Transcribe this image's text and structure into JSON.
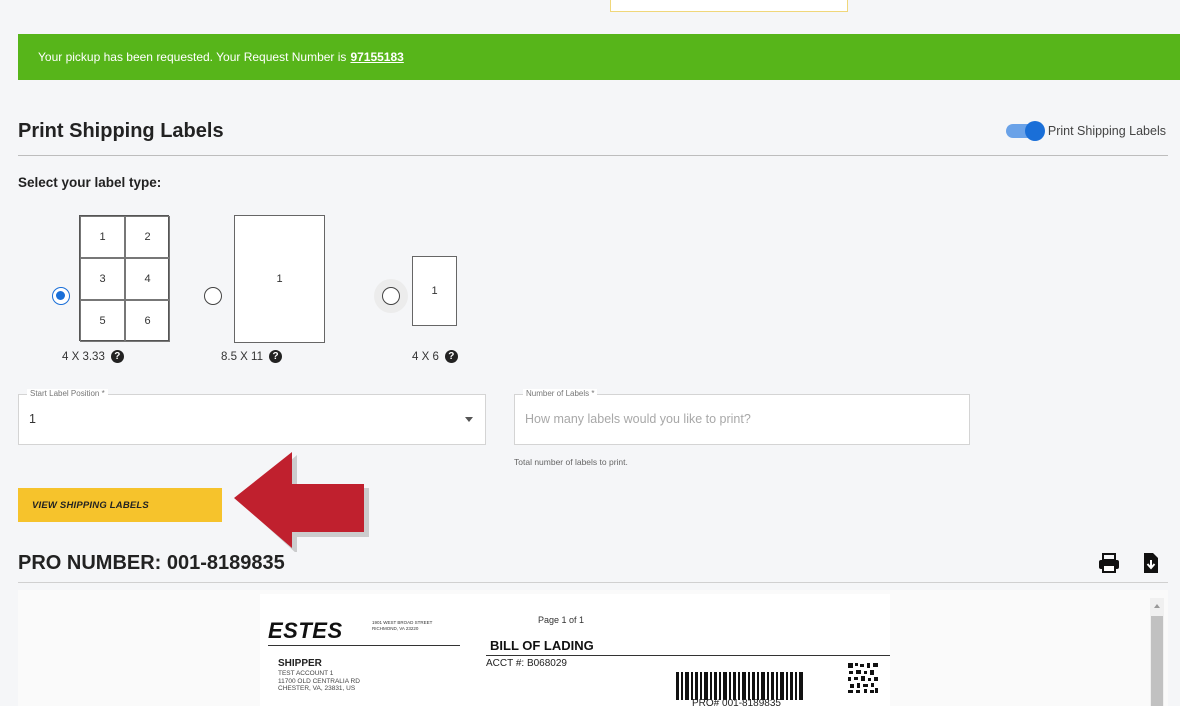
{
  "banner": {
    "text": "Your pickup has been requested. Your Request Number is",
    "request_number": "97155183"
  },
  "section": {
    "title": "Print Shipping Labels",
    "toggle_label": "Print Shipping Labels",
    "toggle_on": true,
    "select_prompt": "Select your label type:"
  },
  "label_types": [
    {
      "caption": "4 X 3.33",
      "cells": [
        "1",
        "2",
        "3",
        "4",
        "5",
        "6"
      ],
      "selected": true
    },
    {
      "caption": "8.5 X 11",
      "cells": [
        "1"
      ],
      "selected": false
    },
    {
      "caption": "4 X 6",
      "cells": [
        "1"
      ],
      "selected": false
    }
  ],
  "help_icon_glyph": "?",
  "start_position": {
    "label": "Start Label Position *",
    "value": "1"
  },
  "number_of_labels": {
    "label": "Number of Labels *",
    "placeholder": "How many labels would you like to print?",
    "helper": "Total number of labels to print."
  },
  "view_button": "VIEW SHIPPING LABELS",
  "pro_title": "PRO NUMBER: 001-8189835",
  "icons": {
    "print": "print-icon",
    "download": "file-download-icon",
    "arrow": "red-arrow-icon"
  },
  "document": {
    "logo": "ESTES",
    "logo_address": [
      "1901 WEST BROAD STREET",
      "RICHMOND, VA 23220"
    ],
    "page_of": "Page 1 of 1",
    "heading": "BILL OF LADING",
    "shipper_heading": "SHIPPER",
    "shipper_lines": [
      "TEST ACCOUNT 1",
      "11700 OLD CENTRALIA RD",
      "CHESTER, VA, 23831, US"
    ],
    "account": "ACCT #: B068029",
    "pro_barcode_text": "PRO# 001-8189835"
  },
  "colors": {
    "banner_green": "#57b51a",
    "button_yellow": "#f6c32c",
    "arrow_red": "#c0202e",
    "radio_blue": "#1a6fd8"
  }
}
